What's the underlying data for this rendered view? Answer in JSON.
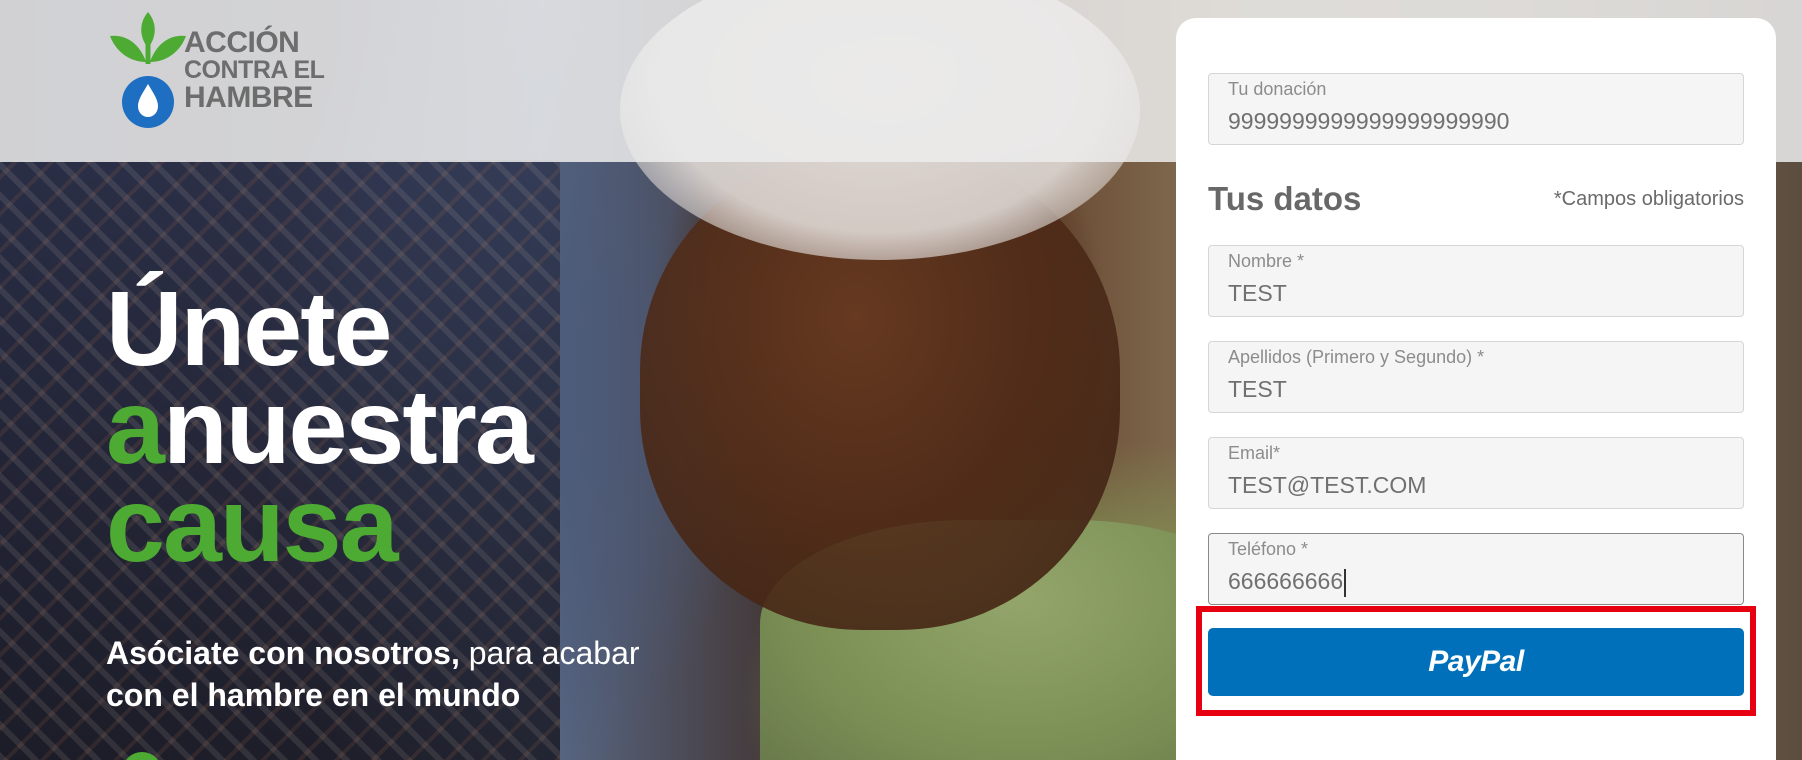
{
  "logo": {
    "lines": [
      "ACCIÓN",
      "CONTRA EL",
      "HAMBRE"
    ],
    "leaf_color": "#4daa33",
    "drop_color": "#1e6fc2"
  },
  "hero": {
    "headline": {
      "line1": "Únete",
      "line2_green": "a",
      "line2_white": "nuestra",
      "line3": "causa"
    },
    "subline": {
      "bold": "Asóciate con nosotros,",
      "regular": "para acabar",
      "bold2": "con el hambre en el mundo"
    },
    "accent_color": "#4daa33"
  },
  "form": {
    "donation": {
      "label": "Tu donación",
      "value": "9999999999999999999990"
    },
    "section_title": "Tus datos",
    "required_note": "*Campos obligatorios",
    "fields": [
      {
        "label": "Nombre *",
        "value": "TEST"
      },
      {
        "label": "Apellidos (Primero y Segundo) *",
        "value": "TEST"
      },
      {
        "label": "Email*",
        "value": "TEST@TEST.COM"
      },
      {
        "label": "Teléfono *",
        "value": "666666666"
      }
    ],
    "paypal_label": "PayPal",
    "paypal_color": "#0070ba",
    "highlight_color": "#e60012"
  }
}
